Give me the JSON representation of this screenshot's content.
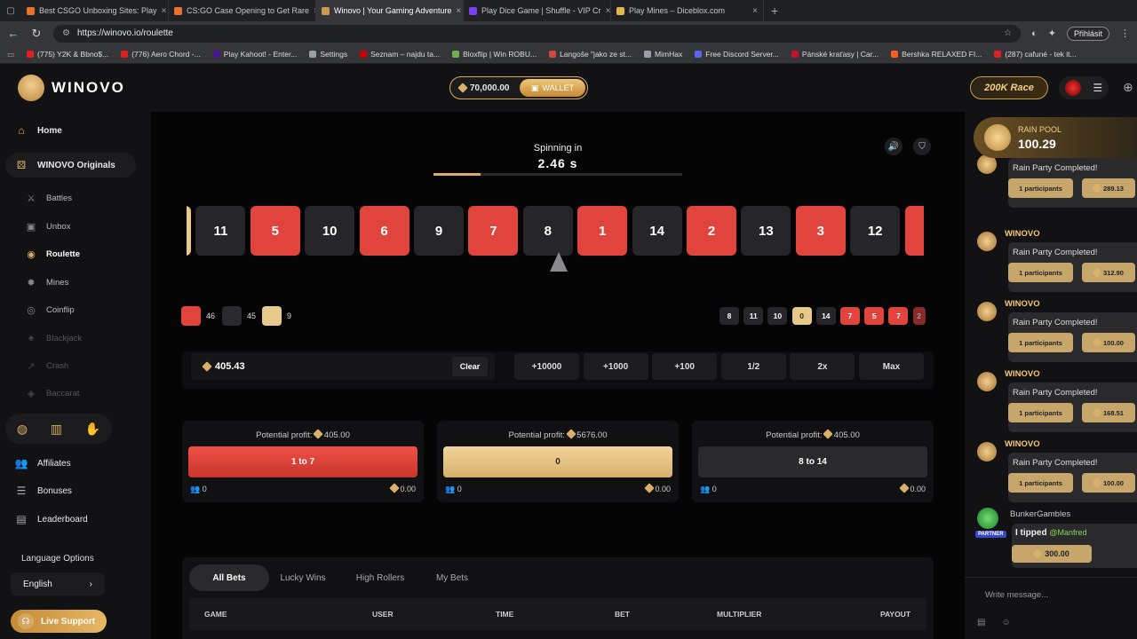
{
  "browser": {
    "tabs": [
      {
        "label": "Best CSGO Unboxing Sites: Play",
        "color": "#e8712c",
        "active": false
      },
      {
        "label": "CS:GO Case Opening to Get Rare",
        "color": "#e8712c",
        "active": false
      },
      {
        "label": "Winovo | Your Gaming Adventure",
        "color": "#c99a4b",
        "active": true
      },
      {
        "label": "Play Dice Game | Shuffle - VIP Cr",
        "color": "#7b3ff2",
        "active": false
      },
      {
        "label": "Play Mines – Diceblox.com",
        "color": "#e0b84a",
        "active": false
      }
    ],
    "url": "https://winovo.io/roulette",
    "signin": "Přihlásit",
    "bookmarks": [
      {
        "label": "(775) Y2K & Bbno$...",
        "color": "#e02020"
      },
      {
        "label": "(776) Aero Chord -...",
        "color": "#e02020"
      },
      {
        "label": "Play Kahoot! - Enter...",
        "color": "#46178f"
      },
      {
        "label": "Settings",
        "color": "#9aa0a6"
      },
      {
        "label": "Seznam – najdu ta...",
        "color": "#cc0000"
      },
      {
        "label": "Bloxflip | Win ROBU...",
        "color": "#6fb24a"
      },
      {
        "label": "Langoše \"jako ze st...",
        "color": "#d4453a"
      },
      {
        "label": "MimHax",
        "color": "#9aa0a6"
      },
      {
        "label": "Free Discord Server...",
        "color": "#5865f2"
      },
      {
        "label": "Pánské kraťasy | Car...",
        "color": "#c8102e"
      },
      {
        "label": "Bershka RELAXED FI...",
        "color": "#ff5a1f"
      },
      {
        "label": "(287) cafuné - tek it...",
        "color": "#e02020"
      }
    ]
  },
  "header": {
    "brand": "WINOVO",
    "balance": "70,000.00",
    "wallet_label": "WALLET",
    "race_label": "200K Race"
  },
  "sidebar": {
    "home": "Home",
    "originals": "WINOVO Originals",
    "games": [
      {
        "label": "Battles",
        "icon": "swords-icon",
        "glyph": "⚔",
        "state": "normal"
      },
      {
        "label": "Unbox",
        "icon": "box-icon",
        "glyph": "▣",
        "state": "normal"
      },
      {
        "label": "Roulette",
        "icon": "roulette-icon",
        "glyph": "◉",
        "state": "active"
      },
      {
        "label": "Mines",
        "icon": "bomb-icon",
        "glyph": "✹",
        "state": "normal"
      },
      {
        "label": "Coinflip",
        "icon": "coin-icon",
        "glyph": "◎",
        "state": "normal"
      },
      {
        "label": "Blackjack",
        "icon": "cards-icon",
        "glyph": "♠",
        "state": "dim"
      },
      {
        "label": "Crash",
        "icon": "chart-icon",
        "glyph": "↗",
        "state": "dim"
      },
      {
        "label": "Baccarat",
        "icon": "baccarat-icon",
        "glyph": "◈",
        "state": "dim"
      }
    ],
    "links": [
      {
        "label": "Affiliates",
        "icon": "users-icon",
        "glyph": "👥"
      },
      {
        "label": "Bonuses",
        "icon": "gift-icon",
        "glyph": "☰"
      },
      {
        "label": "Leaderboard",
        "icon": "trophy-icon",
        "glyph": "▤"
      }
    ],
    "language_label": "Language Options",
    "language_value": "English",
    "support_label": "Live Support"
  },
  "game": {
    "spinning_label": "Spinning in",
    "spinning_time": "2.46 s",
    "progress": 0.19,
    "reel": [
      {
        "n": "",
        "c": "gold"
      },
      {
        "n": "11",
        "c": "black"
      },
      {
        "n": "5",
        "c": "red"
      },
      {
        "n": "10",
        "c": "black"
      },
      {
        "n": "6",
        "c": "red"
      },
      {
        "n": "9",
        "c": "black"
      },
      {
        "n": "7",
        "c": "red"
      },
      {
        "n": "8",
        "c": "black"
      },
      {
        "n": "1",
        "c": "red"
      },
      {
        "n": "14",
        "c": "black"
      },
      {
        "n": "2",
        "c": "red"
      },
      {
        "n": "13",
        "c": "black"
      },
      {
        "n": "3",
        "c": "red"
      },
      {
        "n": "12",
        "c": "black"
      },
      {
        "n": "",
        "c": "red"
      }
    ],
    "counts": [
      {
        "value": "46",
        "color": "#e0443c"
      },
      {
        "value": "45",
        "color": "#2a2a2e"
      },
      {
        "value": "9",
        "color": "#e7c98c"
      }
    ],
    "history": [
      {
        "n": "8",
        "c": "black"
      },
      {
        "n": "11",
        "c": "black"
      },
      {
        "n": "10",
        "c": "black"
      },
      {
        "n": "0",
        "c": "gold"
      },
      {
        "n": "14",
        "c": "black"
      },
      {
        "n": "7",
        "c": "red"
      },
      {
        "n": "5",
        "c": "red"
      },
      {
        "n": "7",
        "c": "red"
      },
      {
        "n": "2",
        "c": "red"
      }
    ],
    "bet_amount": "405.43",
    "clear_label": "Clear",
    "quick_buttons": [
      "+10000",
      "+1000",
      "+100",
      "1/2",
      "2x",
      "Max"
    ],
    "panels": [
      {
        "profit_label": "Potential profit:",
        "profit": "405.00",
        "label": "1 to 7",
        "style": "red",
        "players": "0",
        "total": "0.00"
      },
      {
        "profit_label": "Potential profit:",
        "profit": "5676.00",
        "label": "0",
        "style": "gold",
        "players": "0",
        "total": "0.00"
      },
      {
        "profit_label": "Potential profit:",
        "profit": "405.00",
        "label": "8 to 14",
        "style": "black",
        "players": "0",
        "total": "0.00"
      }
    ]
  },
  "bets": {
    "tabs": [
      "All Bets",
      "Lucky Wins",
      "High Rollers",
      "My Bets"
    ],
    "columns": [
      "GAME",
      "USER",
      "TIME",
      "BET",
      "MULTIPLIER",
      "PAYOUT"
    ]
  },
  "chat": {
    "rain_label": "RAIN POOL",
    "rain_value": "100.29",
    "messages": [
      {
        "name": "",
        "text": "Rain Party Completed!",
        "participants": "1 participants",
        "amount": "289.13"
      },
      {
        "name": "WINOVO",
        "text": "Rain Party Completed!",
        "participants": "1 participants",
        "amount": "312.90"
      },
      {
        "name": "WINOVO",
        "text": "Rain Party Completed!",
        "participants": "1 participants",
        "amount": "100.00"
      },
      {
        "name": "WINOVO",
        "text": "Rain Party Completed!",
        "participants": "1 participants",
        "amount": "168.51"
      },
      {
        "name": "WINOVO",
        "text": "Rain Party Completed!",
        "participants": "1 participants",
        "amount": "100.00"
      }
    ],
    "tip_user": "BunkerGambles",
    "tip_badge": "PARTNER",
    "tip_text": "I tipped",
    "tip_target": "@Manfred",
    "tip_amount": "300.00",
    "input_placeholder": "Write message..."
  }
}
